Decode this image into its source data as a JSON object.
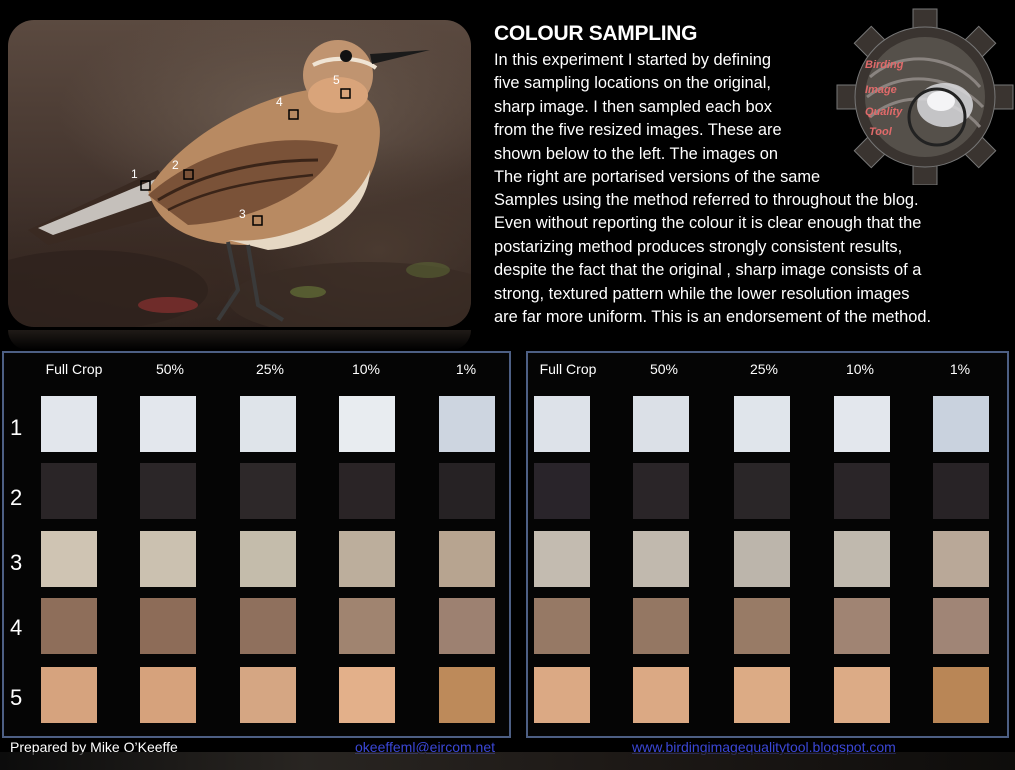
{
  "title": "COLOUR SAMPLING",
  "description_lines_narrow": [
    "In this experiment I started by defining",
    "five sampling locations on the original,",
    "sharp image.  I then sampled each box",
    "from the five resized images.  These are",
    "shown below to the left.  The images  on",
    "The right are portarised versions of the same"
  ],
  "description_lines_wide": [
    "Samples using the method referred to throughout  the blog.",
    "Even without reporting the colour it is clear enough that the",
    "postarizing method produces strongly consistent results,",
    "despite the  fact that the original , sharp image consists of a",
    "strong, textured pattern while the lower resolution images",
    "are far more uniform.  This is an endorsement of the method."
  ],
  "logo": {
    "line1": "Birding",
    "line2": "Image",
    "line3": "Quality",
    "line4": "Tool"
  },
  "photo_markers": [
    "1",
    "2",
    "3",
    "4",
    "5"
  ],
  "column_headers": [
    "Full Crop",
    "50%",
    "25%",
    "10%",
    "1%"
  ],
  "row_labels": [
    "1",
    "2",
    "3",
    "4",
    "5"
  ],
  "swatches_original": [
    [
      "#e2e6ec",
      "#e3e7ed",
      "#dfe4ea",
      "#e8ecf0",
      "#cdd5e0"
    ],
    [
      "#2a2527",
      "#2b2628",
      "#2d2829",
      "#2a2426",
      "#262224"
    ],
    [
      "#cfc4b3",
      "#cbc1b0",
      "#c4bcab",
      "#bcae9c",
      "#b7a490"
    ],
    [
      "#8e6e5a",
      "#8d6c58",
      "#8f705d",
      "#a08470",
      "#9d8171"
    ],
    [
      "#d6a37e",
      "#d6a27c",
      "#d5a683",
      "#e3b08a",
      "#bd8a5a"
    ]
  ],
  "swatches_posterized": [
    [
      "#dde2e9",
      "#dbe0e7",
      "#e0e5eb",
      "#e3e7ed",
      "#c9d2de"
    ],
    [
      "#29242a",
      "#2a2528",
      "#2a2628",
      "#2a2528",
      "#282326"
    ],
    [
      "#c3bbb0",
      "#c1b9ae",
      "#bcb5ab",
      "#c0b9ae",
      "#b9a898"
    ],
    [
      "#967965",
      "#947763",
      "#987b66",
      "#a08473",
      "#a08576"
    ],
    [
      "#dba984",
      "#dba984",
      "#dcab85",
      "#dcab86",
      "#b98656"
    ]
  ],
  "footer": {
    "author": "Prepared by Mike O’Keeffe",
    "email": "okeeffeml@eircom.net",
    "site": "www.birdingimagequalitytool.blogspot.com"
  }
}
